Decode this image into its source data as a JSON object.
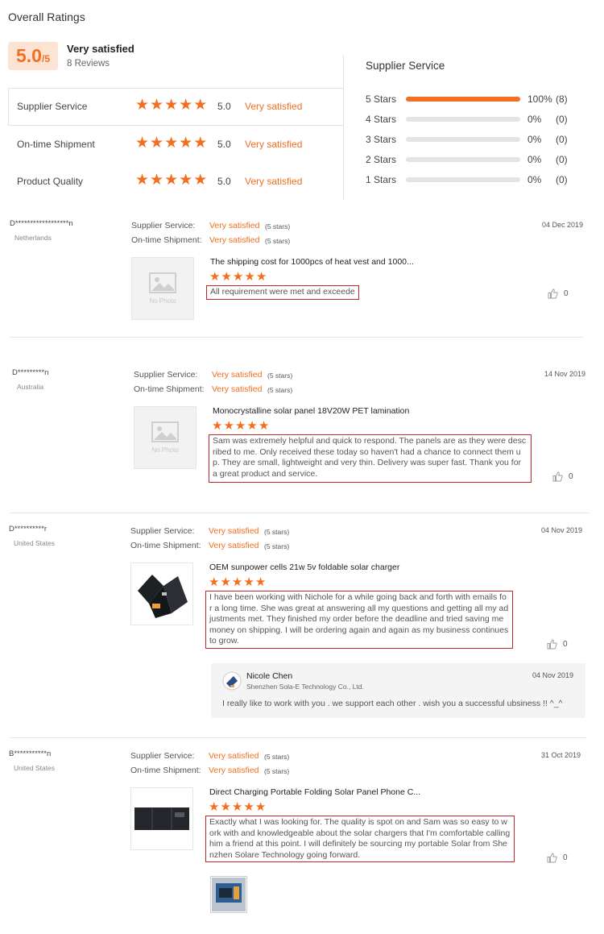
{
  "overall": {
    "heading": "Overall Ratings",
    "score": "5.0",
    "score_max": "/5",
    "summary": "Very satisfied",
    "reviews_count": "8 Reviews",
    "categories": [
      {
        "label": "Supplier Service",
        "score": "5.0",
        "verdict": "Very satisfied",
        "stars": 5
      },
      {
        "label": "On-time Shipment",
        "score": "5.0",
        "verdict": "Very satisfied",
        "stars": 5
      },
      {
        "label": "Product Quality",
        "score": "5.0",
        "verdict": "Very satisfied",
        "stars": 5
      }
    ]
  },
  "breakdown": {
    "title": "Supplier Service",
    "rows": [
      {
        "label": "5 Stars",
        "percent": "100%",
        "count": "(8)",
        "fraction": 1.0
      },
      {
        "label": "4 Stars",
        "percent": "0%",
        "count": "(0)",
        "fraction": 0
      },
      {
        "label": "3 Stars",
        "percent": "0%",
        "count": "(0)",
        "fraction": 0
      },
      {
        "label": "2 Stars",
        "percent": "0%",
        "count": "(0)",
        "fraction": 0
      },
      {
        "label": "1 Stars",
        "percent": "0%",
        "count": "(0)",
        "fraction": 0
      }
    ]
  },
  "labels": {
    "supplier_service": "Supplier Service:",
    "on_time_shipment": "On-time Shipment:",
    "very_satisfied": "Very satisfied",
    "five_stars": "(5 stars)",
    "no_photo": "No Photo"
  },
  "reviews": [
    {
      "user": "D******************n",
      "country": "Netherlands",
      "date": "04 Dec 2019",
      "product": "The shipping cost for 1000pcs of heat vest and 1000...",
      "text": "All requirement were met and exceeded.",
      "likes": "0"
    },
    {
      "user": "D*********n",
      "country": "Australia",
      "date": "14 Nov 2019",
      "product": "Monocrystalline solar panel 18V20W PET lamination",
      "text": "Sam was extremely helpful and quick to respond. The panels are as they were described to me. Only received these today so haven't had a chance to connect them up. They are small, lightweight and very thin. Delivery was super fast. Thank you for a great product and service.",
      "likes": "0"
    },
    {
      "user": "D**********r",
      "country": "United States",
      "date": "04 Nov 2019",
      "product": "OEM sunpower cells 21w 5v foldable solar charger",
      "text": "I have been working with Nichole for a while going back and forth with emails for a long time. She was great at answering all my questions and getting all my adjustments met. They finished my order before the deadline and tried saving me money on shipping. I will be ordering again and again as my business continues to grow.",
      "likes": "0",
      "reply": {
        "name": "Nicole Chen",
        "company": "Shenzhen Sola-E Technology Co., Ltd.",
        "date": "04 Nov 2019",
        "text": "I really like to work with you . we support each other . wish you a successful ubsiness !! ^_^"
      }
    },
    {
      "user": "B***********n",
      "country": "United States",
      "date": "31 Oct 2019",
      "product": "Direct Charging Portable Folding Solar Panel Phone C...",
      "text": "Exactly what I was looking for. The quality is spot on and Sam was so easy to work with and knowledgeable about the solar chargers that I'm comfortable calling him a friend at this point. I will definitely be sourcing my portable Solar from Shenzhen Solare Technology going forward.",
      "likes": "0"
    }
  ],
  "icons": {
    "star": "star-icon",
    "thumb": "thumbs-up-icon",
    "photo": "image-placeholder-icon"
  },
  "colors": {
    "accent": "#f26e21",
    "highlight_border": "#c0272d",
    "score_bg": "#fde3d3"
  }
}
